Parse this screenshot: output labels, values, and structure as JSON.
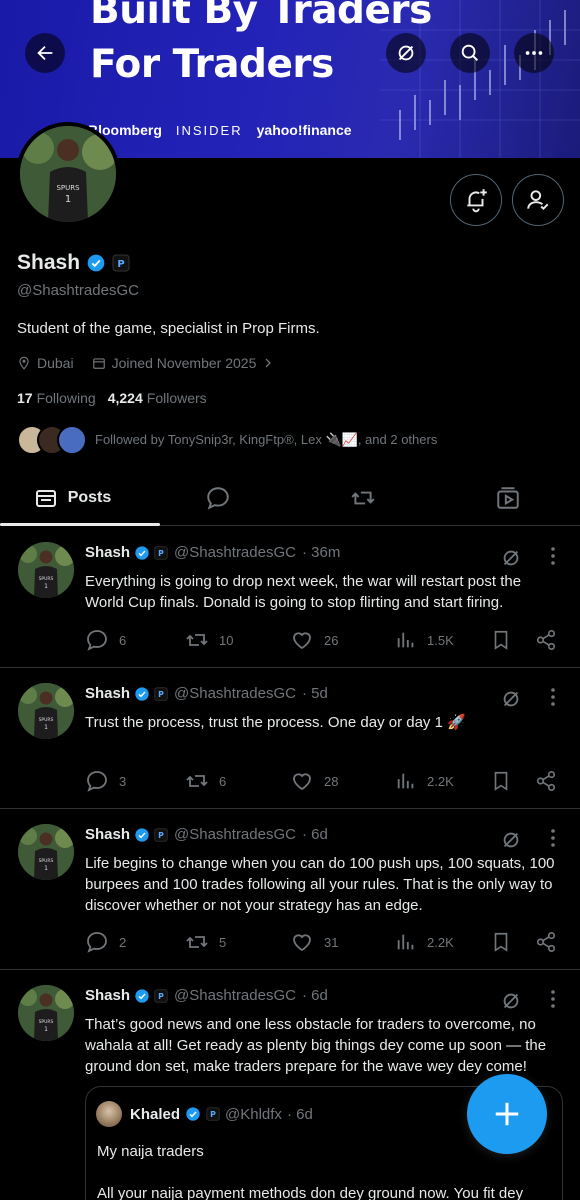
{
  "banner": {
    "title_line1": "Built By Traders",
    "title_line2": "For Traders",
    "press": [
      "Bloomberg",
      "INSIDER",
      "yahoo!finance"
    ]
  },
  "profile": {
    "name": "Shash",
    "handle": "@ShashtradesGC",
    "bio": "Student of the game, specialist in Prop Firms.",
    "location": "Dubai",
    "joined": "Joined November 2025",
    "following_count": "17",
    "following_label": "Following",
    "followers_count": "4,224",
    "followers_label": "Followers",
    "followed_by": "Followed by TonySnip3r, KingFtp®, Lex 🔌📈, and 2 others"
  },
  "tabs": [
    {
      "label": "Posts",
      "icon": "posts-icon"
    },
    {
      "label": "",
      "icon": "reply-icon"
    },
    {
      "label": "",
      "icon": "repost-icon"
    },
    {
      "label": "",
      "icon": "media-icon"
    }
  ],
  "posts": [
    {
      "name": "Shash",
      "handle": "@ShashtradesGC",
      "time": "· 36m",
      "text": "Everything is going to drop next week, the war will restart post the World Cup finals. Donald is going to stop flirting and start firing.",
      "replies": "6",
      "reposts": "10",
      "likes": "26",
      "views": "1.5K"
    },
    {
      "name": "Shash",
      "handle": "@ShashtradesGC",
      "time": "· 5d",
      "text": "Trust the process, trust the process. One day or day 1 🚀",
      "replies": "3",
      "reposts": "6",
      "likes": "28",
      "views": "2.2K"
    },
    {
      "name": "Shash",
      "handle": "@ShashtradesGC",
      "time": "· 6d",
      "text": "Life begins to change when you can do 100 push ups, 100 squats, 100 burpees and 100 trades following all your rules. That is the only way to discover whether or not your strategy has an edge.",
      "replies": "2",
      "reposts": "5",
      "likes": "31",
      "views": "2.2K"
    },
    {
      "name": "Shash",
      "handle": "@ShashtradesGC",
      "time": "· 6d",
      "text": "That’s good news and one less obstacle for traders to overcome, no wahala at all! Get ready as plenty big things dey come up soon — the ground don set, make traders prepare for the wave wey dey come!",
      "quote": {
        "name": "Khaled",
        "handle": "@Khldfx",
        "time": "· 6d",
        "text1": "My naija traders",
        "text2": "All your naija payment methods  don dey ground now. You fit dey"
      }
    }
  ],
  "colors": {
    "accent": "#1d9bf0",
    "muted": "#71767b",
    "text": "#e7e9ea",
    "border": "#2f3336"
  }
}
